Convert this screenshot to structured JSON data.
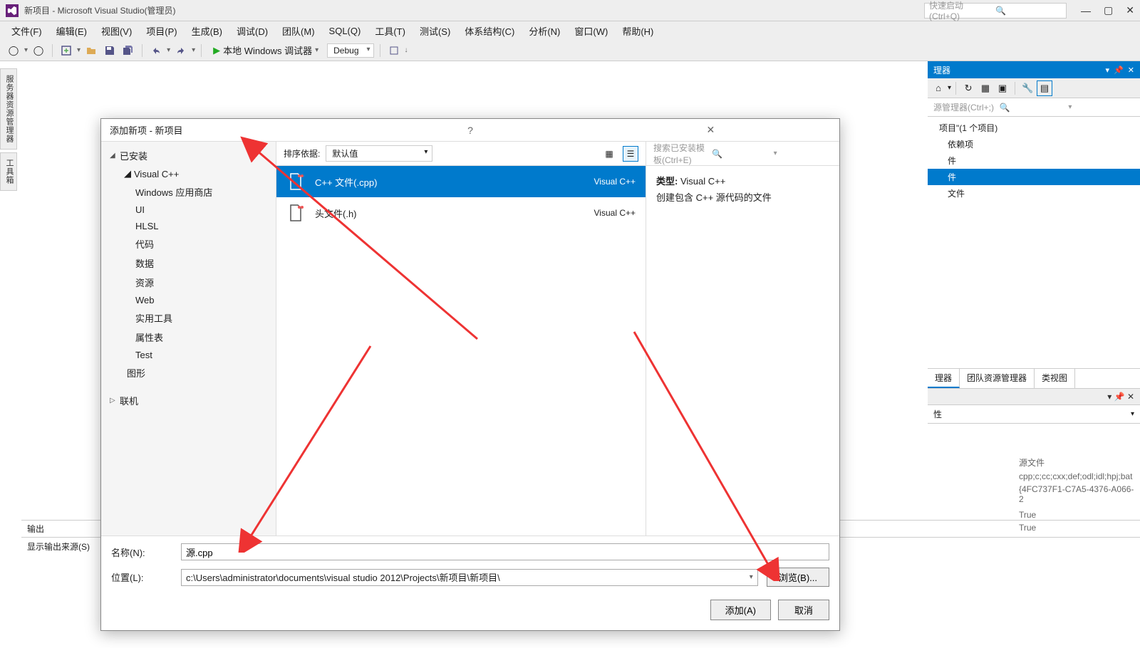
{
  "titlebar": {
    "title": "新项目 - Microsoft Visual Studio(管理员)",
    "quick_launch_placeholder": "快速启动 (Ctrl+Q)"
  },
  "menubar": [
    "文件(F)",
    "编辑(E)",
    "视图(V)",
    "项目(P)",
    "生成(B)",
    "调试(D)",
    "团队(M)",
    "SQL(Q)",
    "工具(T)",
    "测试(S)",
    "体系结构(C)",
    "分析(N)",
    "窗口(W)",
    "帮助(H)"
  ],
  "toolbar": {
    "debugger_label": "本地 Windows 调试器",
    "config": "Debug"
  },
  "left_tabs": [
    "服务器资源管理器",
    "工具箱"
  ],
  "output": {
    "title": "输出",
    "src_label": "显示输出来源(S)"
  },
  "solution_explorer": {
    "title": "理器",
    "search_placeholder": "源管理器(Ctrl+;)",
    "project_text": "项目\"(1 个项目)",
    "items": [
      "依赖项",
      "件",
      "件",
      "文件"
    ],
    "selected_index": 2,
    "tabs": [
      "理器",
      "团队资源管理器",
      "类视图"
    ]
  },
  "properties": {
    "title_suffix": "性",
    "rows": [
      {
        "k": "",
        "v": "源文件"
      },
      {
        "k": "",
        "v": "cpp;c;cc;cxx;def;odl;idl;hpj;bat"
      },
      {
        "k": "",
        "v": "{4FC737F1-C7A5-4376-A066-2"
      },
      {
        "k": "",
        "v": ""
      },
      {
        "k": "",
        "v": "True"
      },
      {
        "k": "",
        "v": "True"
      }
    ]
  },
  "dialog": {
    "title": "添加新项 - 新项目",
    "left_tree": {
      "installed": "已安装",
      "vcpp": "Visual C++",
      "children": [
        "Windows 应用商店",
        "UI",
        "HLSL",
        "代码",
        "数据",
        "资源",
        "Web",
        "实用工具",
        "属性表",
        "Test"
      ],
      "graphics": "图形",
      "online": "联机"
    },
    "sort": {
      "label": "排序依据:",
      "value": "默认值"
    },
    "search_placeholder": "搜索已安装模板(Ctrl+E)",
    "templates": [
      {
        "name": "C++ 文件(.cpp)",
        "lang": "Visual C++",
        "selected": true
      },
      {
        "name": "头文件(.h)",
        "lang": "Visual C++",
        "selected": false
      }
    ],
    "info": {
      "type_label": "类型:",
      "type_value": "Visual C++",
      "desc": "创建包含 C++ 源代码的文件"
    },
    "name_label": "名称(N):",
    "name_value": "源.cpp",
    "location_label": "位置(L):",
    "location_value": "c:\\Users\\administrator\\documents\\visual studio 2012\\Projects\\新项目\\新项目\\",
    "browse": "浏览(B)...",
    "add": "添加(A)",
    "cancel": "取消"
  }
}
